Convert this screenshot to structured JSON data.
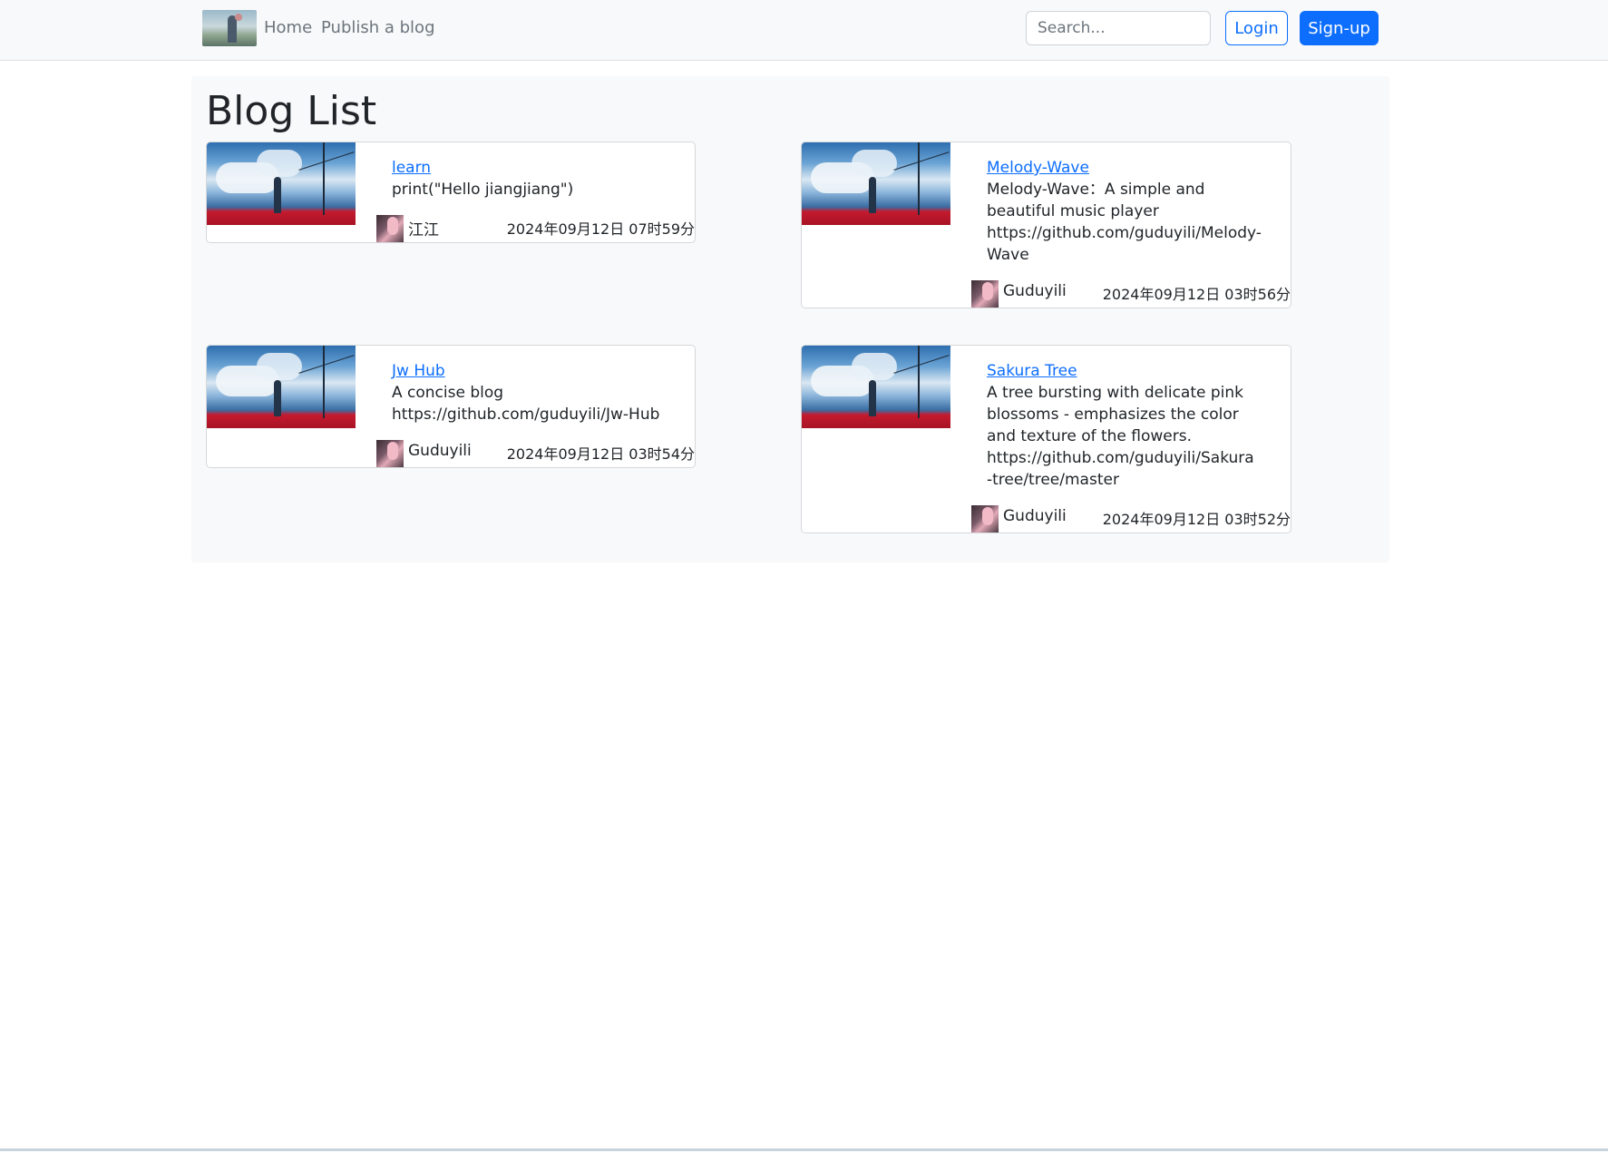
{
  "nav": {
    "home_label": "Home",
    "publish_label": "Publish a blog",
    "search_placeholder": "Search...",
    "login_label": "Login",
    "signup_label": "Sign-up"
  },
  "page": {
    "title": "Blog List"
  },
  "blogs": [
    {
      "title": "learn",
      "description": "print(\"Hello jiangjiang\")",
      "author": "江江",
      "date": "2024年09月12日 07时59分"
    },
    {
      "title": "Melody-Wave",
      "description": "Melody-Wave：A simple and beautiful music player https://github.com/guduyili/Melody-Wave",
      "author": "Guduyili",
      "date": "2024年09月12日 03时56分"
    },
    {
      "title": "Jw Hub",
      "description": "A concise blog https://github.com/guduyili/Jw-Hub",
      "author": "Guduyili",
      "date": "2024年09月12日 03时54分"
    },
    {
      "title": "Sakura Tree",
      "description": "A tree bursting with delicate pink blossoms - emphasizes the color and texture of the flowers. https://github.com/guduyili/Sakura-tree/tree/master",
      "author": "Guduyili",
      "date": "2024年09月12日 03时52分"
    }
  ],
  "colors": {
    "accent": "#0d6efd",
    "navbar_bg": "#f8f9fa",
    "content_bg": "#f8f9fa"
  }
}
